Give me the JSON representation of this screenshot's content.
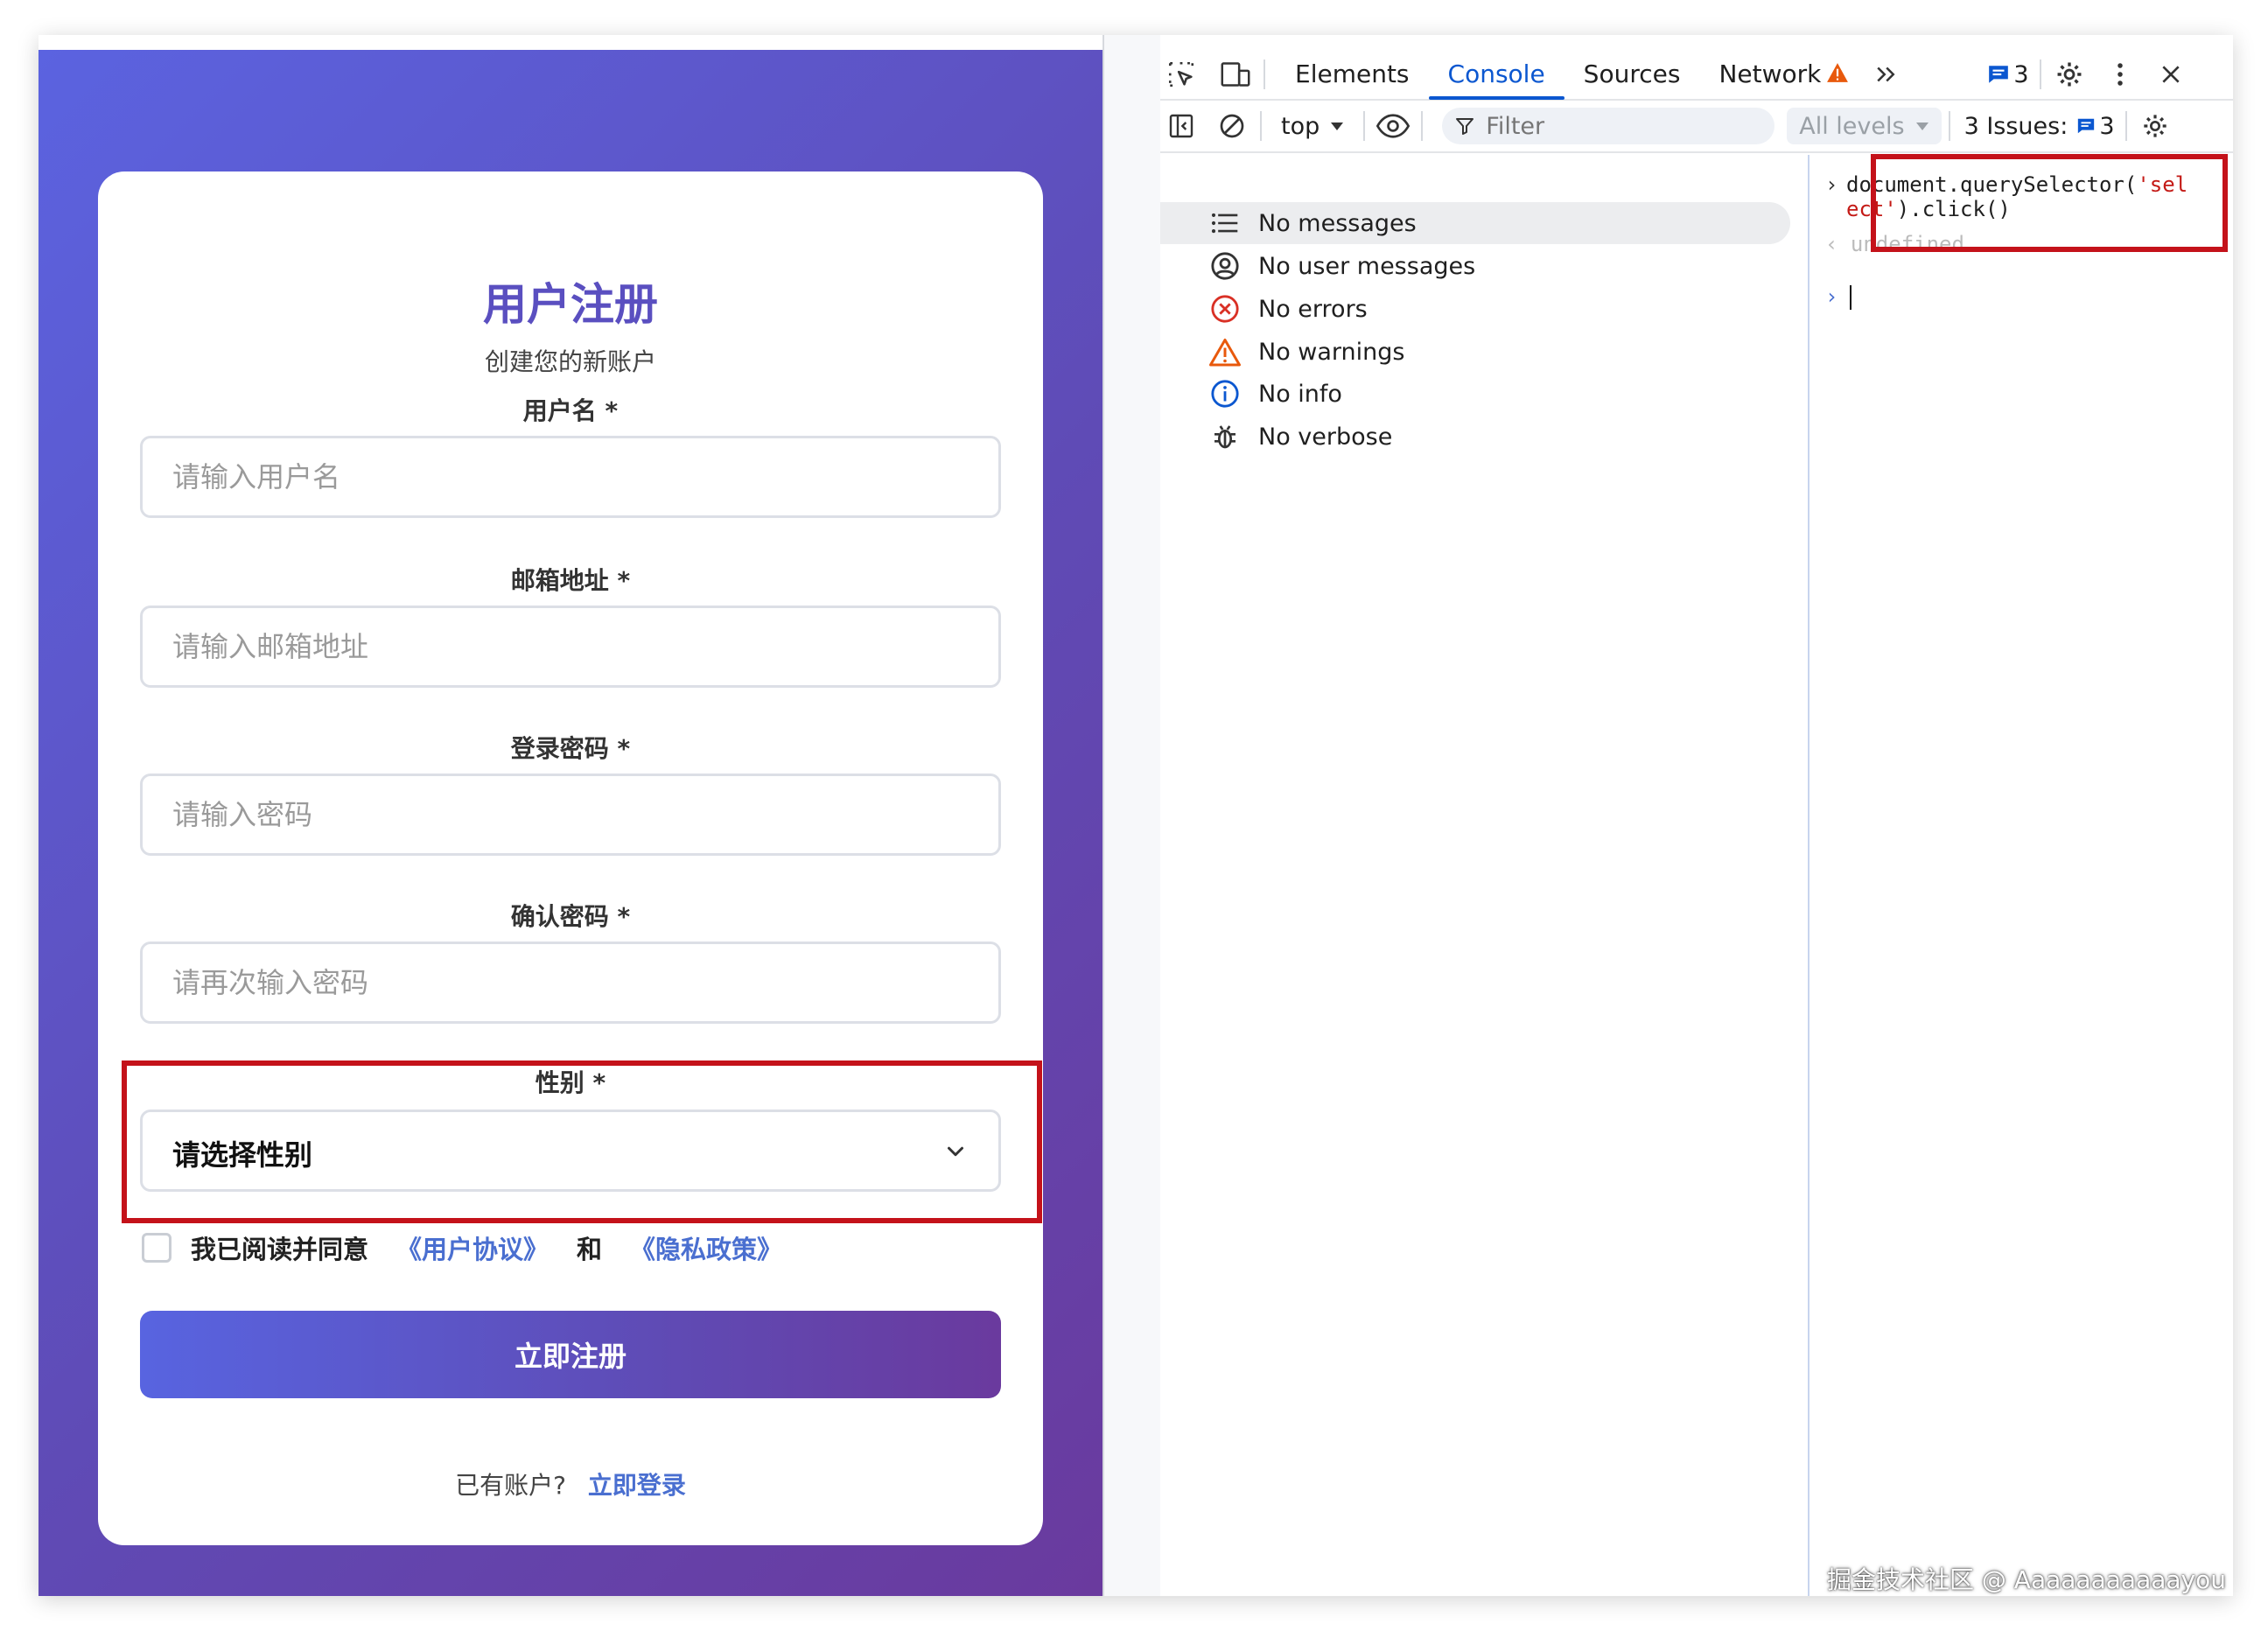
{
  "registration": {
    "title": "用户注册",
    "subtitle": "创建您的新账户",
    "fields": [
      {
        "label": "用户名 *",
        "placeholder": "请输入用户名"
      },
      {
        "label": "邮箱地址 *",
        "placeholder": "请输入邮箱地址"
      },
      {
        "label": "登录密码 *",
        "placeholder": "请输入密码"
      },
      {
        "label": "确认密码 *",
        "placeholder": "请再次输入密码"
      }
    ],
    "gender": {
      "label": "性别 *",
      "value": "请选择性别"
    },
    "agreement": {
      "text": "我已阅读并同意",
      "user_agreement": "《用户协议》",
      "and": "和",
      "privacy_policy": "《隐私政策》"
    },
    "submit_label": "立即注册",
    "login_prompt": "已有账户?",
    "login_link": "立即登录"
  },
  "devtools": {
    "tabs": [
      "Elements",
      "Console",
      "Sources",
      "Network"
    ],
    "active_tab": "Console",
    "messages_badge": "3",
    "context": "top",
    "filter_placeholder": "Filter",
    "levels": "All levels",
    "issues_label": "3 Issues:",
    "issues_count": "3",
    "sidebar": [
      {
        "label": "No messages",
        "icon": "list-icon"
      },
      {
        "label": "No user messages",
        "icon": "user-icon"
      },
      {
        "label": "No errors",
        "icon": "error-icon"
      },
      {
        "label": "No warnings",
        "icon": "warning-icon"
      },
      {
        "label": "No info",
        "icon": "info-icon"
      },
      {
        "label": "No verbose",
        "icon": "bug-icon"
      }
    ],
    "console": {
      "code_prefix": "document.querySelector(",
      "code_string": "'select'",
      "code_suffix": ").click()",
      "result": "undefined"
    }
  },
  "watermark": "掘金技术社区 @ Aaaaaaaaaaayou",
  "colors": {
    "accent": "#5a4fc0",
    "link": "#4a6fd0",
    "highlight": "#c4121a",
    "devtools_active": "#0b57d0"
  }
}
